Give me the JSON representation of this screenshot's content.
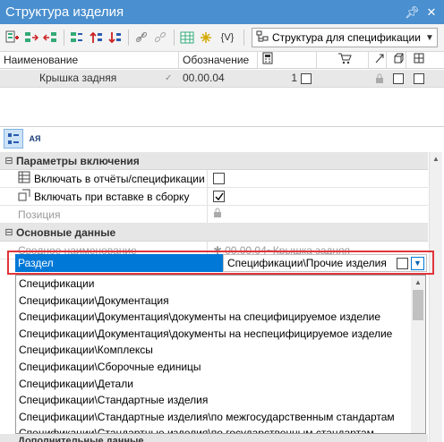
{
  "window": {
    "title": "Структура изделия",
    "pin_icon": "pin-icon",
    "close_icon": "close-icon"
  },
  "toolbar": {
    "icons": [
      "add-object-icon",
      "insert-after-icon",
      "insert-before-icon",
      "split-icon",
      "sort-up-icon",
      "sort-down-icon",
      "link-icon",
      "unlink-icon",
      "table-icon",
      "star-icon",
      "variables-icon",
      "structure-icon"
    ],
    "variables_label": "{V}",
    "combo_value": "Структура для спецификации"
  },
  "grid": {
    "headers": [
      "Наименование",
      "Обозначение"
    ],
    "row": {
      "name": "Крышка задняя",
      "designation": "00.00.04",
      "quantity": "1"
    }
  },
  "sortbar": {
    "icons": [
      "categorized-icon",
      "alphabetical-sort-icon"
    ],
    "alpha_label": "АЯ"
  },
  "properties": {
    "group1": {
      "title": "Параметры включения",
      "rows": [
        {
          "label": "Включать в отчёты/спецификации те",
          "checked": false
        },
        {
          "label": "Включать при вставке в сборку",
          "checked": true
        },
        {
          "label": "Позиция"
        }
      ]
    },
    "group2": {
      "title": "Основные данные",
      "summary_label": "Сводное наименование",
      "summary_value": "00.00.04~Крышка задняя",
      "razdel_label": "Раздел",
      "razdel_value": "Спецификации\\Прочие изделия"
    },
    "group3_title": "Дополнительные данные"
  },
  "dropdown": {
    "options": [
      "Спецификации",
      "Спецификации\\Документация",
      "Спецификации\\Документация\\документы на специфицируемое изделие",
      "Спецификации\\Документация\\документы на неспецифицируемое изделие",
      "Спецификации\\Комплексы",
      "Спецификации\\Сборочные единицы",
      "Спецификации\\Детали",
      "Спецификации\\Стандартные изделия",
      "Спецификации\\Стандартные изделия\\по межгосударственным стандартам",
      "Спецификации\\Стандартные изделия\\по государственным стандартам"
    ]
  },
  "colors": {
    "title_bar": "#4a8fcf",
    "selection": "#0078d7",
    "highlight_frame": "#e0353b"
  }
}
